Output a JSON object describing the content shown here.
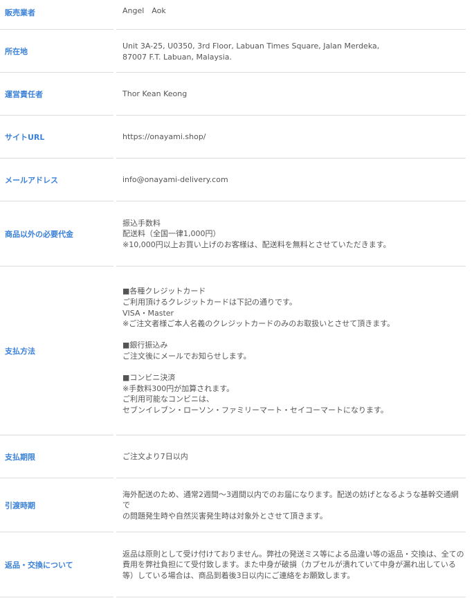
{
  "rows": [
    {
      "label": "販売業者",
      "lines": [
        "Angel　Aok"
      ]
    },
    {
      "label": "所在地",
      "lines": [
        "Unit 3A-25, U0350, 3rd Floor, Labuan Times Square, Jalan Merdeka,",
        "87007 F.T. Labuan, Malaysia."
      ]
    },
    {
      "label": "運営責任者",
      "lines": [
        "Thor Kean Keong"
      ]
    },
    {
      "label": "サイトURL",
      "lines": [
        "https://onayami.shop/"
      ]
    },
    {
      "label": "メールアドレス",
      "lines": [
        "info@onayami-delivery.com"
      ]
    },
    {
      "label": "商品以外の必要代金",
      "lines": [
        "振込手数料",
        "配送料（全国一律1,000円）",
        "※10,000円以上お買い上げのお客様は、配送料を無料とさせていただきます。"
      ]
    },
    {
      "label": "支払方法",
      "lines": [
        "■各種クレジットカード",
        "ご利用頂けるクレジットカードは下記の通りです。",
        "VISA・Master",
        "※ご注文者様ご本人名義のクレジットカードのみのお取扱いとさせて頂きます。",
        "",
        "■銀行振込み",
        "ご注文後にメールでお知らせします。",
        "",
        "■コンビニ決済",
        "※手数料300円が加算されます。",
        "ご利用可能なコンビニは、",
        "セブンイレブン・ローソン・ファミリーマート・セイコーマートになります。"
      ]
    },
    {
      "label": "支払期限",
      "lines": [
        "ご注文より7日以内"
      ]
    },
    {
      "label": "引渡時期",
      "lines": [
        "海外配送のため、通常2週間～3週間以内でのお届になります。配送の妨げとなるような基幹交通網で",
        "の問題発生時や自然災害発生時は対象外とさせて頂きます。"
      ]
    },
    {
      "label": "返品・交換について",
      "lines": [
        "返品は原則として受け付けておりません。弊社の発送ミス等による品違い等の返品・交換は、全ての",
        "費用を弊社負担にて受付致します。また中身が破損（カプセルが潰れていて中身が漏れ出している",
        "等）している場合は、商品到着後3日以内にご連絡をお願致します。"
      ]
    }
  ]
}
